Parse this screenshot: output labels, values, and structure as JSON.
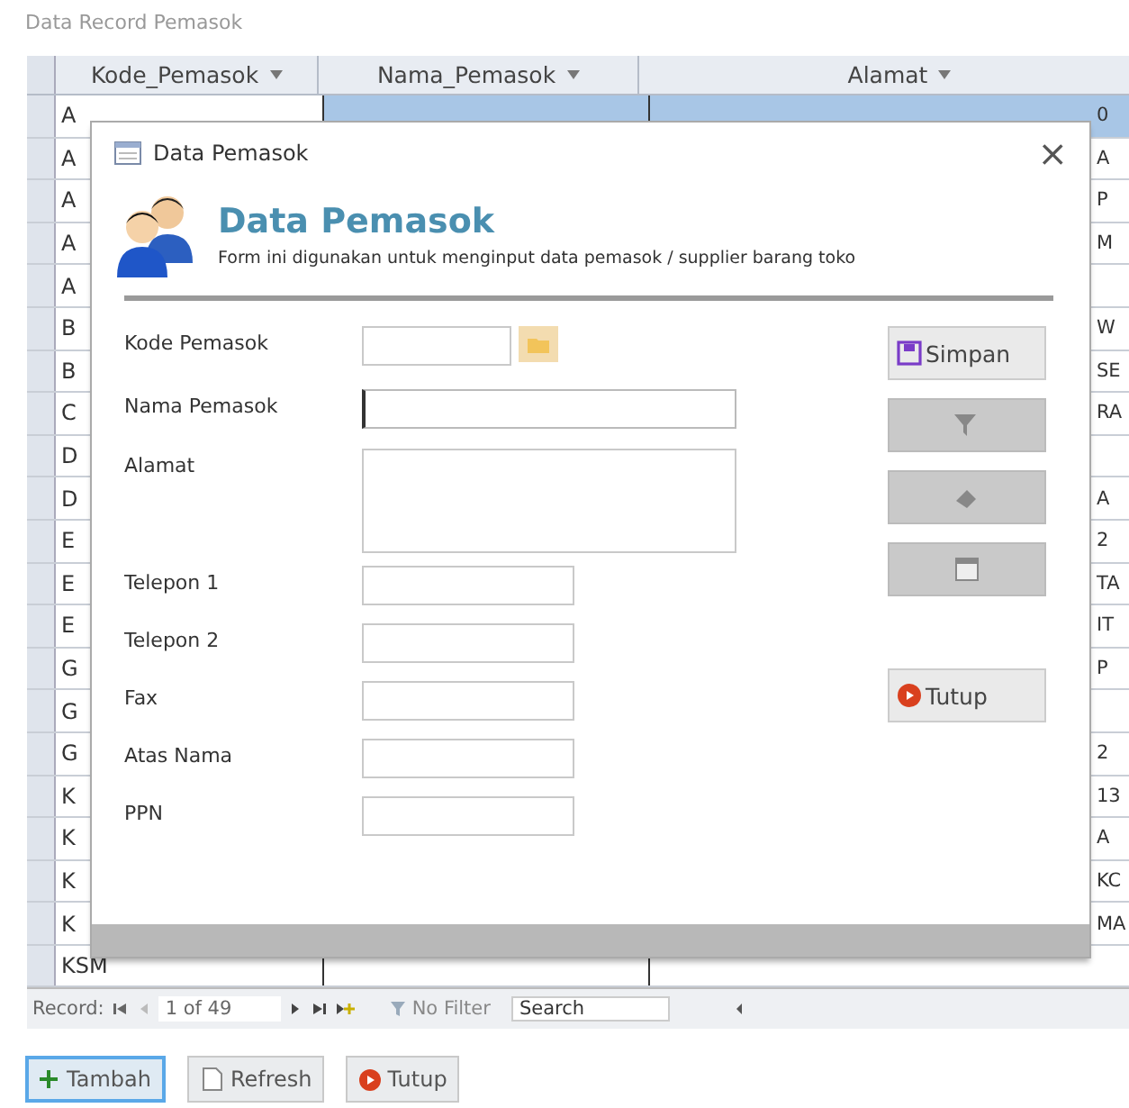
{
  "page_title": "Data Record Pemasok",
  "table": {
    "columns": [
      "Kode_Pemasok",
      "Nama_Pemasok",
      "Alamat"
    ],
    "rows": [
      {
        "code": "A",
        "tail": "0",
        "selected": true
      },
      {
        "code": "A",
        "tail": "A",
        "selected": false
      },
      {
        "code": "A",
        "tail": "P",
        "selected": false
      },
      {
        "code": "A",
        "tail": "M",
        "selected": false
      },
      {
        "code": "A",
        "tail": "",
        "selected": false
      },
      {
        "code": "B",
        "tail": "W",
        "selected": false
      },
      {
        "code": "B",
        "tail": "SE",
        "selected": false
      },
      {
        "code": "C",
        "tail": "RA",
        "selected": false
      },
      {
        "code": "D",
        "tail": "",
        "selected": false
      },
      {
        "code": "D",
        "tail": "A",
        "selected": false
      },
      {
        "code": "E",
        "tail": "2",
        "selected": false
      },
      {
        "code": "E",
        "tail": "TA",
        "selected": false
      },
      {
        "code": "E",
        "tail": "IT",
        "selected": false
      },
      {
        "code": "G",
        "tail": "P",
        "selected": false
      },
      {
        "code": "G",
        "tail": "",
        "selected": false
      },
      {
        "code": "G",
        "tail": "2",
        "selected": false
      },
      {
        "code": "K",
        "tail": "13",
        "selected": false
      },
      {
        "code": "K",
        "tail": "A",
        "selected": false
      },
      {
        "code": "K",
        "tail": "KC",
        "selected": false
      },
      {
        "code": "K",
        "tail": "MA",
        "selected": false
      },
      {
        "code": "KSM",
        "tail": "",
        "selected": false
      }
    ]
  },
  "navigator": {
    "label": "Record:",
    "position": "1 of 49",
    "filter": "No Filter",
    "search": "Search"
  },
  "bottom_buttons": [
    {
      "label": "Tambah",
      "kind": "add",
      "selected": true
    },
    {
      "label": "Refresh",
      "kind": "refresh",
      "selected": false
    },
    {
      "label": "Tutup",
      "kind": "close",
      "selected": false
    }
  ],
  "dialog": {
    "title": "Data Pemasok",
    "close": "×",
    "heading": "Data Pemasok",
    "subtitle": "Form ini digunakan untuk menginput data pemasok / supplier barang toko",
    "fields": [
      {
        "label": "Kode Pemasok",
        "kind": "code"
      },
      {
        "label": "Nama Pemasok",
        "kind": "wide"
      },
      {
        "label": "Alamat",
        "kind": "area"
      },
      {
        "label": "Telepon 1",
        "kind": "short"
      },
      {
        "label": "Telepon 2",
        "kind": "short"
      },
      {
        "label": "Fax",
        "kind": "short"
      },
      {
        "label": "Atas Nama",
        "kind": "short"
      },
      {
        "label": "PPN",
        "kind": "short"
      }
    ],
    "buttons": [
      {
        "label": "Simpan",
        "kind": "save",
        "disabled": false
      },
      {
        "kind": "filter",
        "disabled": true
      },
      {
        "kind": "delete",
        "disabled": true
      },
      {
        "kind": "edit",
        "disabled": true
      },
      {
        "label": "Tutup",
        "kind": "close",
        "disabled": false
      }
    ]
  }
}
